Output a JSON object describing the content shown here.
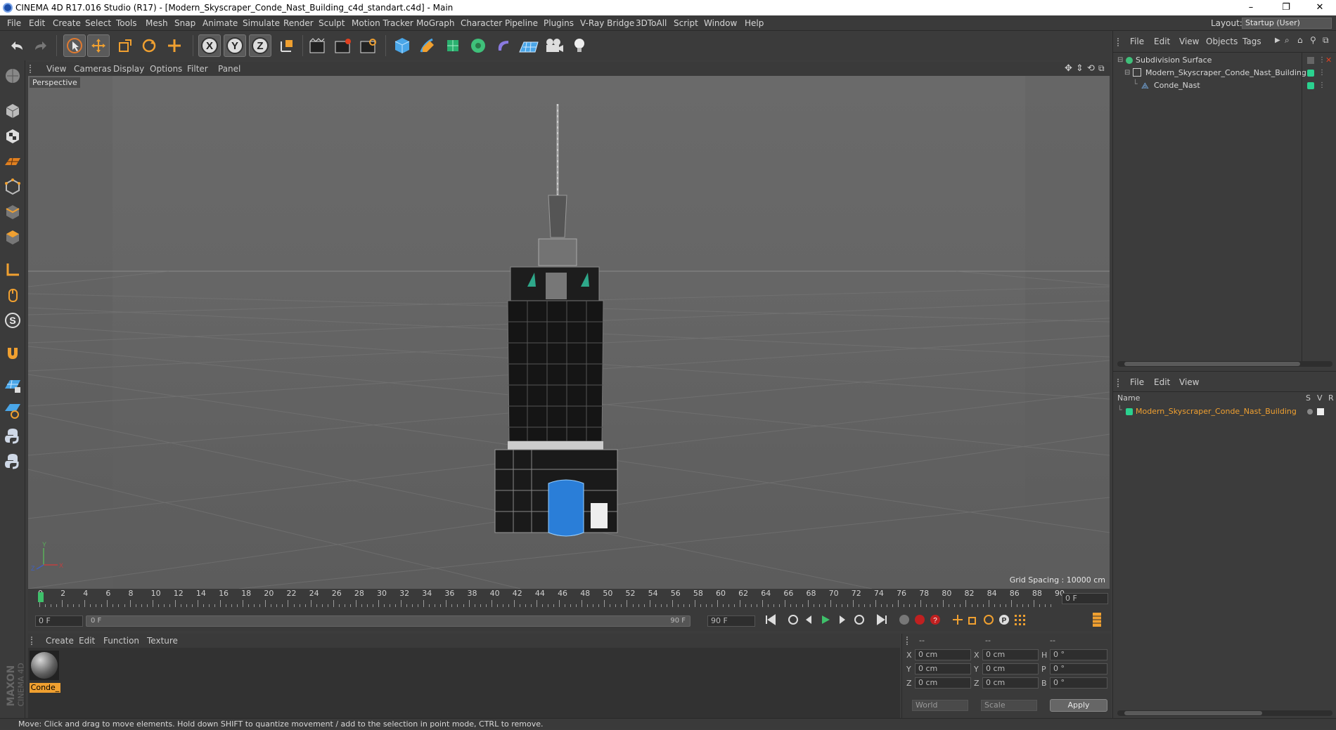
{
  "window": {
    "title": "CINEMA 4D R17.016 Studio (R17) - [Modern_Skyscraper_Conde_Nast_Building_c4d_standart.c4d] - Main",
    "minimize": "–",
    "maximize": "❐",
    "close": "✕"
  },
  "menubar": {
    "items": [
      "File",
      "Edit",
      "Create",
      "Select",
      "Tools",
      "Mesh",
      "Snap",
      "Animate",
      "Simulate",
      "Render",
      "Sculpt",
      "Motion Tracker",
      "MoGraph",
      "Character",
      "Pipeline",
      "Plugins",
      "V-Ray Bridge",
      "3DToAll",
      "Script",
      "Window",
      "Help"
    ],
    "layout_label": "Layout:",
    "layout_value": "Startup (User)"
  },
  "toolbar": {
    "icons": [
      "undo-icon",
      "redo-icon",
      "select-icon",
      "move-icon",
      "scale-icon",
      "rotate-icon",
      "last-tool-icon",
      "x-axis-icon",
      "y-axis-icon",
      "z-axis-icon",
      "coordinate-system-icon",
      "render-view-icon",
      "render-picture-viewer-icon",
      "edit-render-settings-icon",
      "cube-icon",
      "pen-icon",
      "subdivision-icon",
      "array-icon",
      "deformer-icon",
      "floor-icon",
      "camera-icon",
      "light-icon"
    ]
  },
  "viewport": {
    "menu": [
      "View",
      "Cameras",
      "Display",
      "Options",
      "Filter",
      "Panel"
    ],
    "label": "Perspective",
    "grid_spacing": "Grid Spacing : 10000 cm"
  },
  "timeline": {
    "ticks": [
      "0",
      "2",
      "4",
      "6",
      "8",
      "10",
      "12",
      "14",
      "16",
      "18",
      "20",
      "22",
      "24",
      "26",
      "28",
      "30",
      "32",
      "34",
      "36",
      "38",
      "40",
      "42",
      "44",
      "46",
      "48",
      "50",
      "52",
      "54",
      "56",
      "58",
      "60",
      "62",
      "64",
      "66",
      "68",
      "70",
      "72",
      "74",
      "76",
      "78",
      "80",
      "82",
      "84",
      "86",
      "88",
      "90"
    ],
    "current_frame": "0 F",
    "start_frame": "0 F",
    "range_start": "0 F",
    "range_end": "90 F",
    "end_frame": "90 F"
  },
  "materials": {
    "menu": [
      "Create",
      "Edit",
      "Function",
      "Texture"
    ],
    "items": [
      {
        "label": "Conde_"
      }
    ]
  },
  "coordinates": {
    "headers": [
      "--",
      "--",
      "--"
    ],
    "rows": [
      {
        "a": "X",
        "av": "0 cm",
        "b": "X",
        "bv": "0 cm",
        "c": "H",
        "cv": "0 °"
      },
      {
        "a": "Y",
        "av": "0 cm",
        "b": "Y",
        "bv": "0 cm",
        "c": "P",
        "cv": "0 °"
      },
      {
        "a": "Z",
        "av": "0 cm",
        "b": "Z",
        "bv": "0 cm",
        "c": "B",
        "cv": "0 °"
      }
    ],
    "mode": "World",
    "transform": "Scale",
    "apply": "Apply"
  },
  "object_manager": {
    "menu": [
      "File",
      "Edit",
      "View",
      "Objects",
      "Tags"
    ],
    "objects": [
      {
        "name": "Subdivision Surface",
        "level": 0
      },
      {
        "name": "Modern_Skyscraper_Conde_Nast_Building",
        "level": 1
      },
      {
        "name": "Conde_Nast",
        "level": 2
      }
    ]
  },
  "attribute_manager": {
    "menu": [
      "File",
      "Edit",
      "View"
    ],
    "columns": {
      "name": "Name",
      "s": "S",
      "v": "V",
      "r": "R"
    },
    "rows": [
      {
        "name": "Modern_Skyscraper_Conde_Nast_Building"
      }
    ]
  },
  "statusbar": {
    "text": "Move: Click and drag to move elements. Hold down SHIFT to quantize movement / add to the selection in point mode, CTRL to remove."
  },
  "brand": {
    "maxon": "MAXON",
    "cinema": "CINEMA 4D"
  },
  "colors": {
    "accent": "#f0a030",
    "selected_object": "#f0a030",
    "tag_green": "#2bd18f"
  }
}
